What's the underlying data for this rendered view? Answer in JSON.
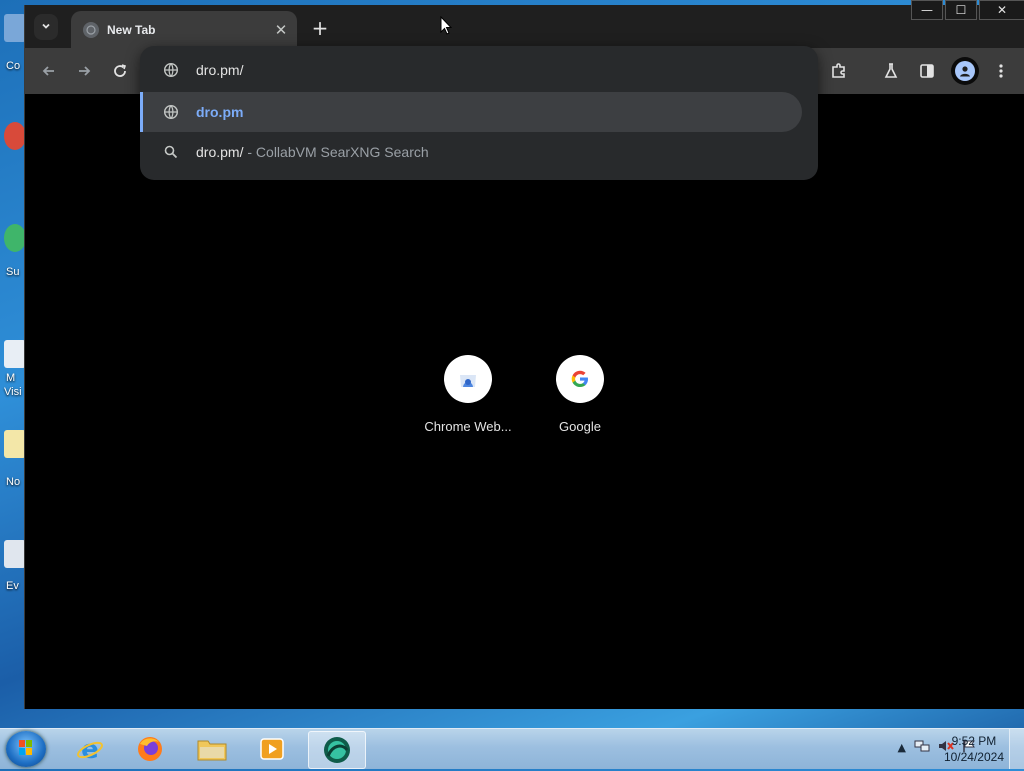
{
  "desktop": {
    "icons": [
      {
        "label": "Co"
      },
      {
        "label": "Su"
      },
      {
        "label": "M"
      },
      {
        "label": "Visi"
      },
      {
        "label": "No"
      },
      {
        "label": "Ev"
      }
    ]
  },
  "browser": {
    "tab": {
      "title": "New Tab"
    },
    "omnibox": {
      "input_text": "dro.pm/",
      "suggestions": [
        {
          "text": "dro.pm",
          "icon": "globe-icon",
          "selected": true
        },
        {
          "text": "dro.pm/",
          "separator": " - ",
          "suffix": "CollabVM SearXNG Search",
          "icon": "search-icon"
        }
      ]
    },
    "shortcuts": [
      {
        "label": "Chrome Web...",
        "icon": "chrome-web-store-icon"
      },
      {
        "label": "Google",
        "icon": "google-icon"
      }
    ],
    "window_controls": {
      "minimize": "—",
      "maximize": "☐",
      "close": "✕"
    }
  },
  "taskbar": {
    "apps": [
      {
        "name": "internet-explorer"
      },
      {
        "name": "firefox"
      },
      {
        "name": "file-explorer"
      },
      {
        "name": "media-player"
      },
      {
        "name": "browser-active"
      }
    ],
    "clock": {
      "time": "9:52 PM",
      "date": "10/24/2024"
    }
  },
  "colors": {
    "accent": "#7cacf8",
    "toolbar": "#3c3c3c",
    "omnibox": "#282a2c"
  }
}
